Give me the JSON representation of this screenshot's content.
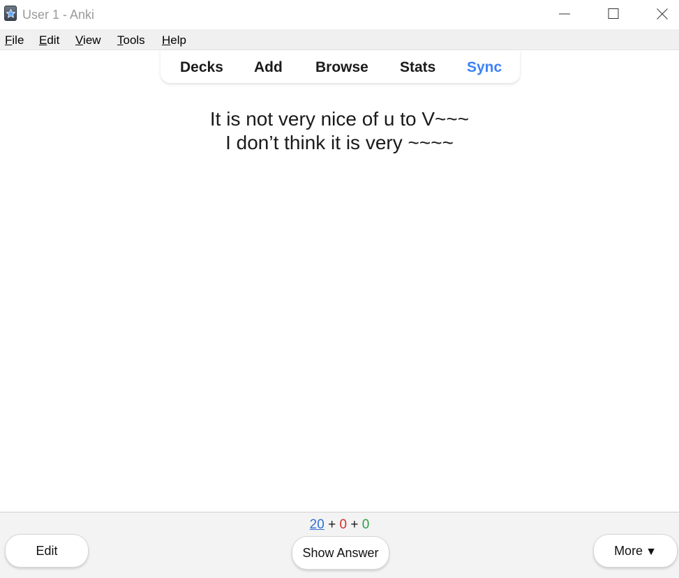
{
  "window": {
    "title": "User 1 - Anki"
  },
  "menu": {
    "file": {
      "accel": "F",
      "rest": "ile"
    },
    "edit": {
      "accel": "E",
      "rest": "dit"
    },
    "view": {
      "accel": "V",
      "rest": "iew"
    },
    "tools": {
      "accel": "T",
      "rest": "ools"
    },
    "help": {
      "accel": "H",
      "rest": "elp"
    }
  },
  "toolbar": {
    "decks": "Decks",
    "add": "Add",
    "browse": "Browse",
    "stats": "Stats",
    "sync": "Sync",
    "sync_color": "#3b82f6"
  },
  "card": {
    "line1": "It is not very nice of u to V~~~",
    "line2": "I don’t think it is very ~~~~"
  },
  "counts": {
    "new": "20",
    "learn": "0",
    "review": "0",
    "plus": "+",
    "new_color": "#2f6fd6",
    "learn_color": "#d32f2f",
    "review_color": "#2e9e45"
  },
  "buttons": {
    "edit": "Edit",
    "show_answer": "Show Answer",
    "more": "More",
    "more_arrow": "▼"
  },
  "icons": {
    "app": "anki-star-icon",
    "minimize": "minimize-icon",
    "maximize": "maximize-icon",
    "close": "close-icon"
  }
}
